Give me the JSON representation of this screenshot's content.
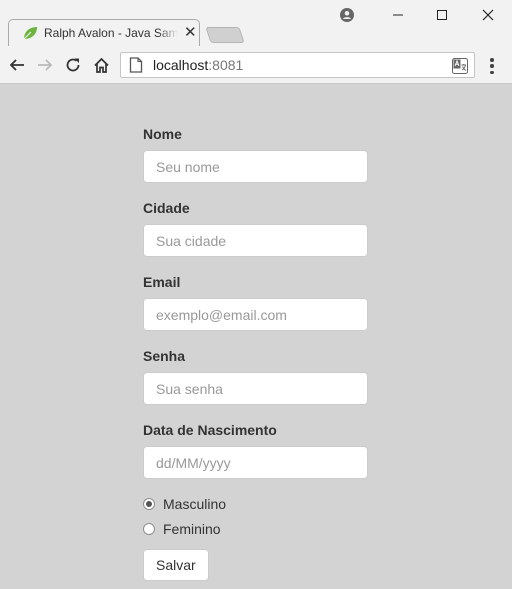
{
  "browser": {
    "tab": {
      "title": "Ralph Avalon - Java Sample",
      "close_glyph": "✕",
      "favicon": "spring-leaf-icon"
    },
    "address": {
      "host": "localhost",
      "port": ":8081"
    },
    "window_controls": {
      "minimize": "—",
      "maximize": "☐",
      "close": "✕"
    }
  },
  "form": {
    "fields": [
      {
        "label": "Nome",
        "placeholder": "Seu nome"
      },
      {
        "label": "Cidade",
        "placeholder": "Sua cidade"
      },
      {
        "label": "Email",
        "placeholder": "exemplo@email.com"
      },
      {
        "label": "Senha",
        "placeholder": "Sua senha"
      },
      {
        "label": "Data de Nascimento",
        "placeholder": "dd/MM/yyyy"
      }
    ],
    "gender": {
      "options": [
        {
          "label": "Masculino",
          "checked": true
        },
        {
          "label": "Feminino",
          "checked": false
        }
      ]
    },
    "submit_label": "Salvar"
  },
  "colors": {
    "page_background": "#d3d3d3",
    "chrome_background": "#f2f2f2",
    "leaf_green": "#6db33f"
  }
}
